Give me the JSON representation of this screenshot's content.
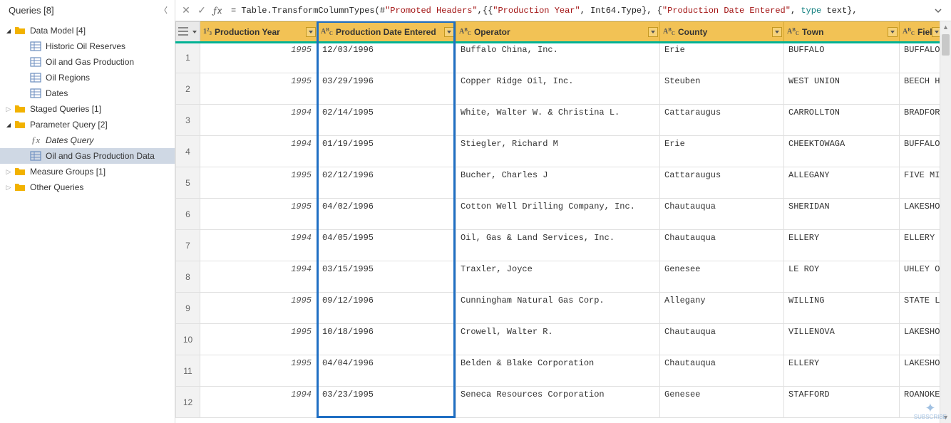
{
  "panel": {
    "title": "Queries [8]",
    "tree": [
      {
        "type": "folder",
        "label": "Data Model [4]",
        "depth": 0,
        "expanded": true
      },
      {
        "type": "table",
        "label": "Historic Oil Reserves",
        "depth": 1
      },
      {
        "type": "table",
        "label": "Oil and Gas Production",
        "depth": 1
      },
      {
        "type": "table",
        "label": "Oil Regions",
        "depth": 1
      },
      {
        "type": "table",
        "label": "Dates",
        "depth": 1
      },
      {
        "type": "folder",
        "label": "Staged Queries [1]",
        "depth": 0,
        "expanded": false
      },
      {
        "type": "folder",
        "label": "Parameter Query [2]",
        "depth": 0,
        "expanded": true
      },
      {
        "type": "fx",
        "label": "Dates Query",
        "depth": 1,
        "italic": true
      },
      {
        "type": "table",
        "label": "Oil and Gas Production Data",
        "depth": 1,
        "selected": true
      },
      {
        "type": "folder",
        "label": "Measure Groups [1]",
        "depth": 0,
        "expanded": false
      },
      {
        "type": "folder",
        "label": "Other Queries",
        "depth": 0,
        "expanded": false
      }
    ]
  },
  "formula": {
    "prefix": "= Table.TransformColumnTypes(#",
    "quoted_promoted": "\"Promoted Headers\"",
    "mid1": ",{{",
    "quoted_col1": "\"Production Year\"",
    "mid2": ", Int64.Type}, {",
    "quoted_col2": "\"Production Date Entered\"",
    "mid3": ", ",
    "kw_type": "type",
    "mid4": " text},"
  },
  "columns": [
    {
      "key": "year",
      "label": "Production Year",
      "dtype": "num"
    },
    {
      "key": "date",
      "label": "Production Date Entered",
      "dtype": "abc"
    },
    {
      "key": "op",
      "label": "Operator",
      "dtype": "abc"
    },
    {
      "key": "county",
      "label": "County",
      "dtype": "abc"
    },
    {
      "key": "town",
      "label": "Town",
      "dtype": "abc"
    },
    {
      "key": "field",
      "label": "Field",
      "dtype": "abc"
    }
  ],
  "rows": [
    {
      "n": 1,
      "year": "1995",
      "date": "12/03/1996",
      "op": "Buffalo China, Inc.",
      "county": "Erie",
      "town": "BUFFALO",
      "field": "BUFFALO"
    },
    {
      "n": 2,
      "year": "1995",
      "date": "03/29/1996",
      "op": "Copper Ridge Oil, Inc.",
      "county": "Steuben",
      "town": "WEST UNION",
      "field": "BEECH H"
    },
    {
      "n": 3,
      "year": "1994",
      "date": "02/14/1995",
      "op": "White, Walter W. & Christina L.",
      "county": "Cattaraugus",
      "town": "CARROLLTON",
      "field": "BRADFOR"
    },
    {
      "n": 4,
      "year": "1994",
      "date": "01/19/1995",
      "op": "Stiegler, Richard M",
      "county": "Erie",
      "town": "CHEEKTOWAGA",
      "field": "BUFFALO"
    },
    {
      "n": 5,
      "year": "1995",
      "date": "02/12/1996",
      "op": "Bucher, Charles J",
      "county": "Cattaraugus",
      "town": "ALLEGANY",
      "field": "FIVE MI"
    },
    {
      "n": 6,
      "year": "1995",
      "date": "04/02/1996",
      "op": "Cotton Well Drilling Company,  Inc.",
      "county": "Chautauqua",
      "town": "SHERIDAN",
      "field": "LAKESHO"
    },
    {
      "n": 7,
      "year": "1994",
      "date": "04/05/1995",
      "op": "Oil, Gas & Land Services, Inc.",
      "county": "Chautauqua",
      "town": "ELLERY",
      "field": "ELLERY"
    },
    {
      "n": 8,
      "year": "1994",
      "date": "03/15/1995",
      "op": "Traxler, Joyce",
      "county": "Genesee",
      "town": "LE ROY",
      "field": "UHLEY O"
    },
    {
      "n": 9,
      "year": "1995",
      "date": "09/12/1996",
      "op": "Cunningham Natural Gas Corp.",
      "county": "Allegany",
      "town": "WILLING",
      "field": "STATE L"
    },
    {
      "n": 10,
      "year": "1995",
      "date": "10/18/1996",
      "op": "Crowell, Walter R.",
      "county": "Chautauqua",
      "town": "VILLENOVA",
      "field": "LAKESHO"
    },
    {
      "n": 11,
      "year": "1995",
      "date": "04/04/1996",
      "op": "Belden & Blake Corporation",
      "county": "Chautauqua",
      "town": "ELLERY",
      "field": "LAKESHO"
    },
    {
      "n": 12,
      "year": "1994",
      "date": "03/23/1995",
      "op": "Seneca Resources Corporation",
      "county": "Genesee",
      "town": "STAFFORD",
      "field": "ROANOKE"
    }
  ],
  "watermark": "SUBSCRIBE"
}
